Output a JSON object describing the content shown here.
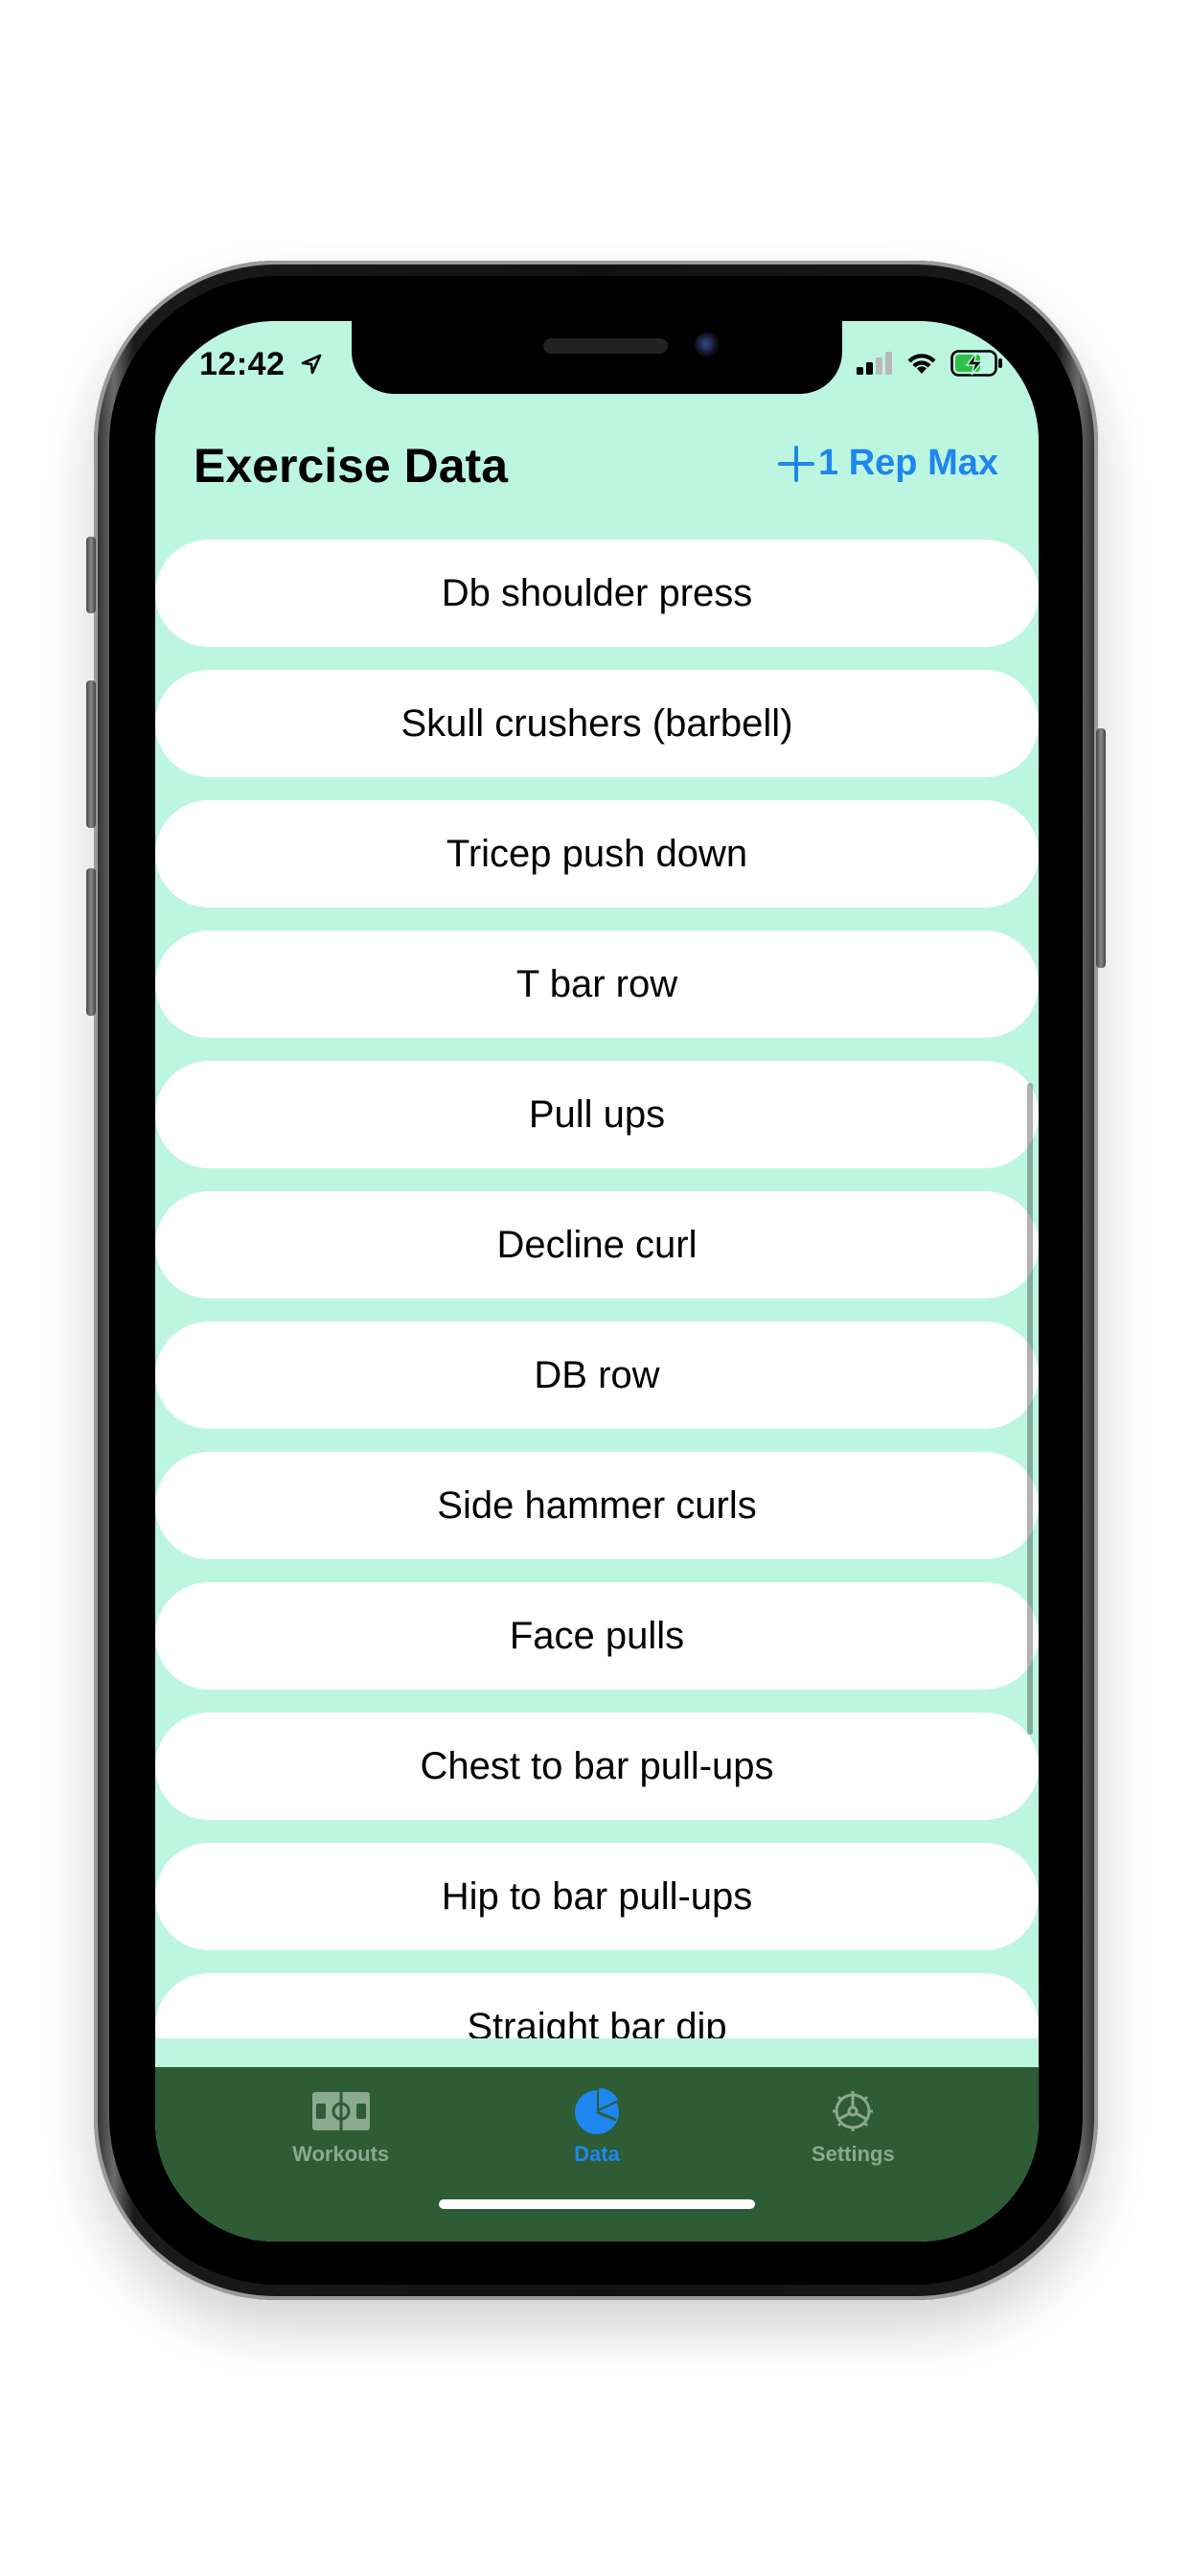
{
  "status_bar": {
    "time": "12:42",
    "location_icon": "location-arrow-icon",
    "signal_icon": "cellular-signal-icon",
    "wifi_icon": "wifi-icon",
    "battery_icon": "battery-charging-icon"
  },
  "header": {
    "title": "Exercise Data",
    "action_label": "1 Rep Max",
    "action_icon": "plus-icon"
  },
  "exercises": [
    "Db shoulder press",
    "Skull crushers (barbell)",
    "Tricep push down",
    "T bar row",
    "Pull ups",
    "Decline curl",
    "DB row",
    "Side hammer curls",
    "Face pulls",
    "Chest to bar pull-ups",
    "Hip to bar pull-ups",
    "Straight bar dip"
  ],
  "tabs": [
    {
      "label": "Workouts",
      "icon": "workouts-icon",
      "active": false
    },
    {
      "label": "Data",
      "icon": "pie-chart-icon",
      "active": true
    },
    {
      "label": "Settings",
      "icon": "gear-icon",
      "active": false
    }
  ],
  "colors": {
    "background": "#bdf6e0",
    "accent": "#1e86ef",
    "tabbar": "#2d5c35",
    "tab_inactive": "#8aa98e",
    "row": "#ffffff"
  }
}
